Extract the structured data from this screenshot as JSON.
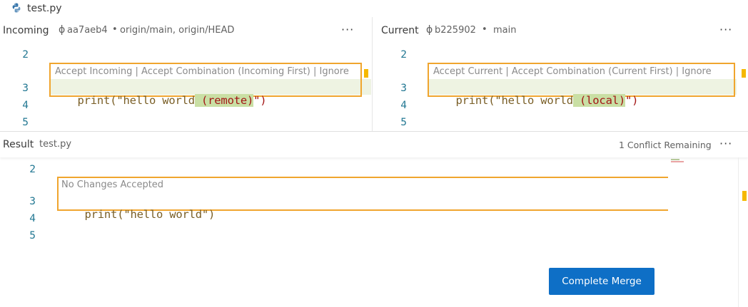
{
  "tab": {
    "file_icon": "python-file-icon",
    "title": "test.py"
  },
  "incoming": {
    "label": "Incoming",
    "commit": "aa7aeb4",
    "refs": "origin/main, origin/HEAD",
    "codelens": "Accept Incoming | Accept Combination (Incoming First) | Ignore",
    "lines": [
      "2",
      "3",
      "4",
      "5"
    ],
    "code_prefix": "print(\"hello world",
    "code_highlight": " (remote)",
    "code_suffix": "\")"
  },
  "current": {
    "label": "Current",
    "commit": "b225902",
    "refs": "main",
    "codelens": "Accept Current | Accept Combination (Current First) | Ignore",
    "lines": [
      "2",
      "3",
      "4",
      "5"
    ],
    "code_prefix": "print(\"hello world",
    "code_highlight": " (local)",
    "code_suffix": "\")"
  },
  "result": {
    "label": "Result",
    "file": "test.py",
    "status": "1 Conflict Remaining",
    "codelens": "No Changes Accepted",
    "lines": [
      "2",
      "3",
      "4",
      "5"
    ],
    "code": "print(\"hello world\")",
    "complete_label": "Complete Merge"
  },
  "icons": {
    "more": "···",
    "commit": "ϕ"
  },
  "colors": {
    "accent": "#0e6fc6",
    "conflict": "#f0a52e",
    "highlight": "#c9dfa4"
  }
}
